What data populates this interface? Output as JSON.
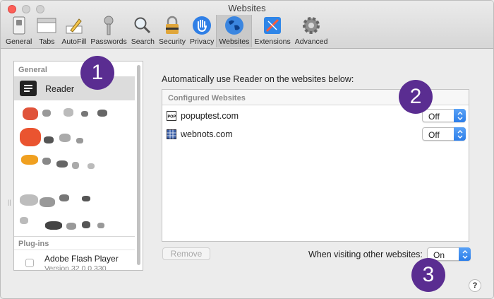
{
  "window": {
    "title": "Websites"
  },
  "toolbar": {
    "items": [
      {
        "label": "General"
      },
      {
        "label": "Tabs"
      },
      {
        "label": "AutoFill"
      },
      {
        "label": "Passwords"
      },
      {
        "label": "Search"
      },
      {
        "label": "Security"
      },
      {
        "label": "Privacy"
      },
      {
        "label": "Websites"
      },
      {
        "label": "Extensions"
      },
      {
        "label": "Advanced"
      }
    ],
    "active": "Websites"
  },
  "sidebar": {
    "general_header": "General",
    "selected_item": "Reader",
    "plugins_header": "Plug-ins",
    "plugin": {
      "name": "Adobe Flash Player",
      "version": "Version 32.0.0.330"
    }
  },
  "main": {
    "description": "Automatically use Reader on the websites below:",
    "configured_header": "Configured Websites",
    "sites": [
      {
        "name": "popuptest.com",
        "value": "Off",
        "favicon": "POP"
      },
      {
        "name": "webnots.com",
        "value": "Off",
        "favicon": "grid"
      }
    ],
    "remove_label": "Remove",
    "other_label": "When visiting other websites:",
    "other_value": "On",
    "help": "?"
  },
  "annotations": [
    "1",
    "2",
    "3"
  ],
  "colors": {
    "badge": "#5a2d91",
    "accent": "#2b7de9",
    "close": "#fc5f57"
  }
}
